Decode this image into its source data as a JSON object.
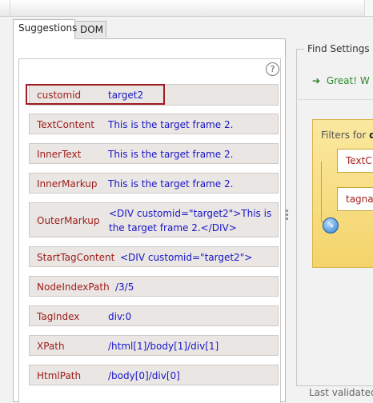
{
  "tabs": [
    {
      "label": "Suggestions"
    },
    {
      "label": "DOM"
    }
  ],
  "help_icon": "?",
  "rows": [
    {
      "key": "customid",
      "value": "target2"
    },
    {
      "key": "TextContent",
      "value": "This is the target frame 2."
    },
    {
      "key": "InnerText",
      "value": "This is the target frame 2."
    },
    {
      "key": "InnerMarkup",
      "value": "This is the target frame 2."
    },
    {
      "key": "OuterMarkup",
      "value": "<DIV customid=\"target2\">This is",
      "value2": "the target frame 2.</DIV>"
    },
    {
      "key": "StartTagContent",
      "value": "<DIV customid=\"target2\">"
    },
    {
      "key": "NodeIndexPath",
      "value": "/3/5"
    },
    {
      "key": "TagIndex",
      "value": "div:0"
    },
    {
      "key": "XPath",
      "value": "/html[1]/body[1]/div[1]"
    },
    {
      "key": "HtmlPath",
      "value": "/body[0]/div[0]"
    }
  ],
  "right": {
    "find_settings": "Find Settings",
    "great_message": "Great! W",
    "filters_label": "Filters for ",
    "filters_bold": "di",
    "filter_items": [
      "TextC",
      "tagna"
    ],
    "last_validated": "Last validated"
  },
  "colors": {
    "key": "#9e1b17",
    "value": "#1a16c8",
    "highlight": "#a01b24",
    "great": "#2b8a2b"
  }
}
